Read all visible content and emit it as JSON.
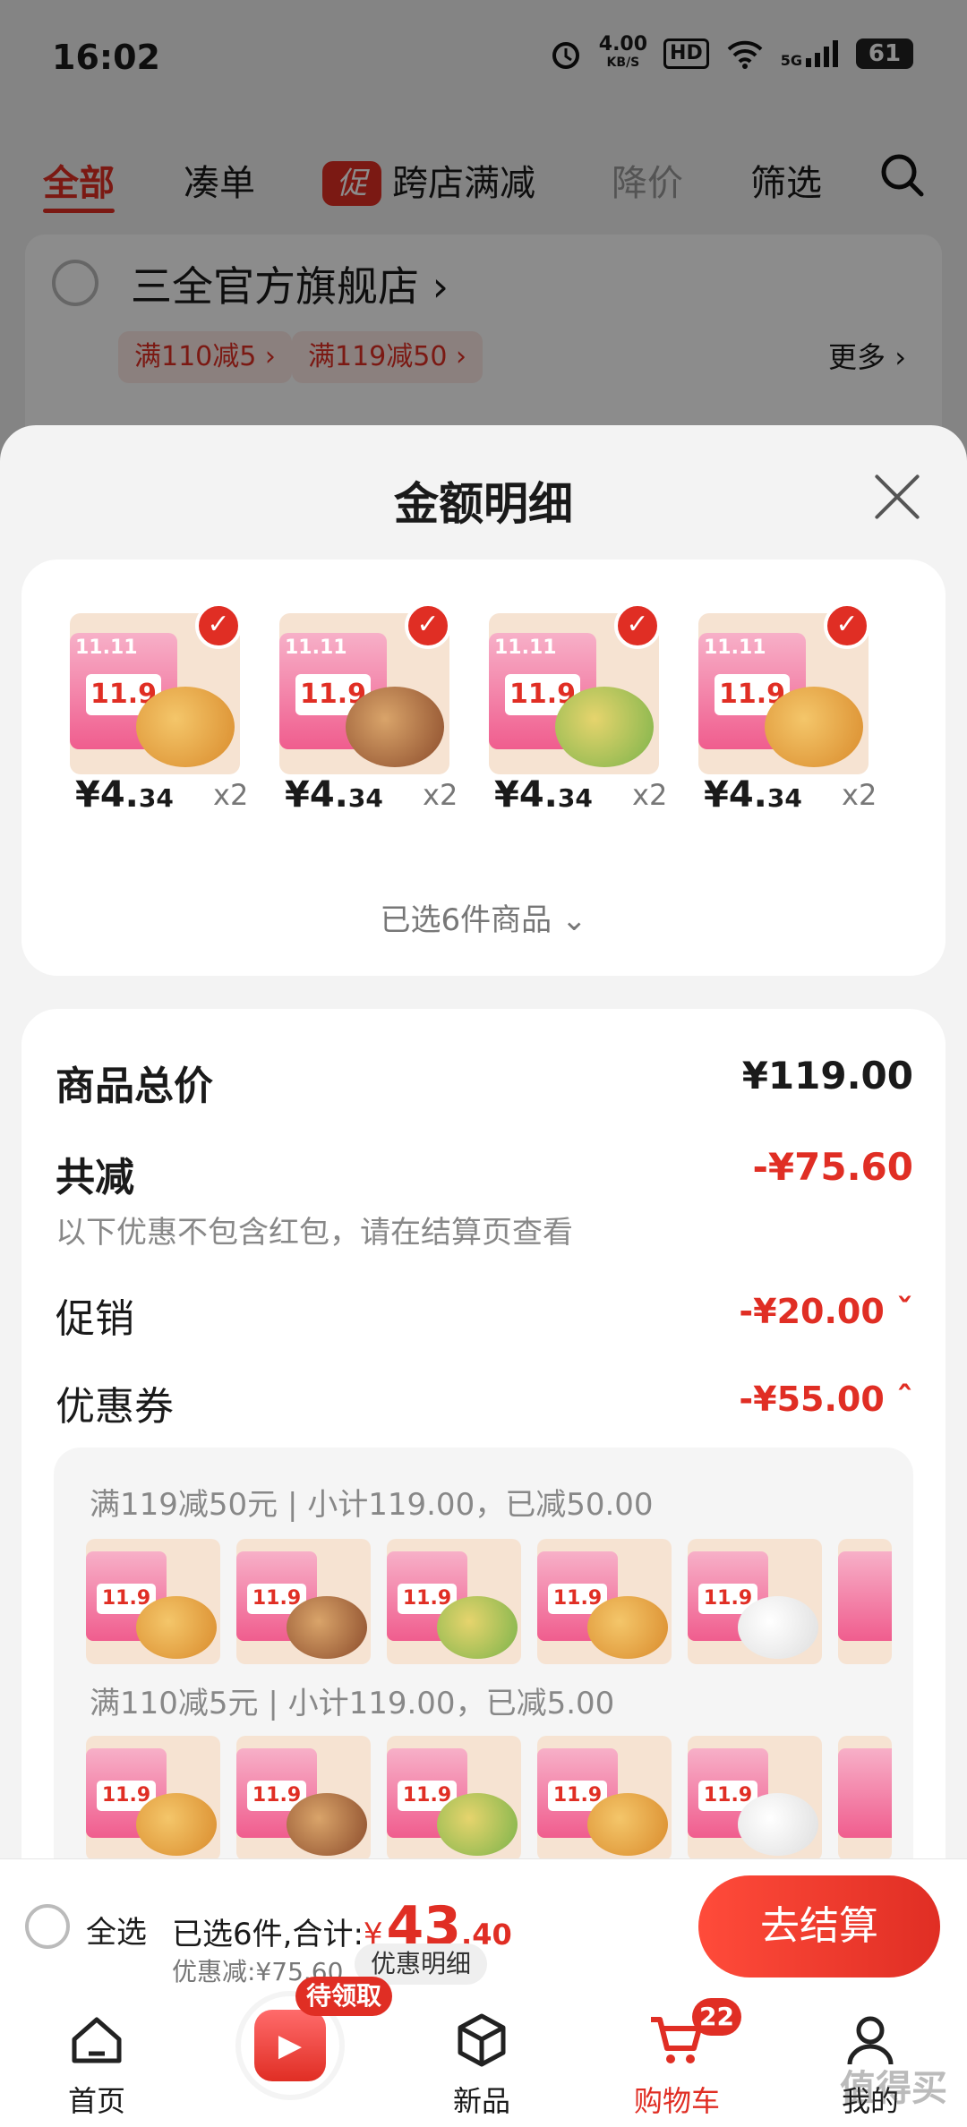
{
  "status_bar": {
    "time": "16:02",
    "speed": "4.00",
    "speed_unit": "KB/S",
    "hd": "HD",
    "network": "5G",
    "battery": "61"
  },
  "filters": {
    "all": "全部",
    "coudan": "凑单",
    "cross_icon": "促",
    "cross": "跨店满减",
    "price_drop": "降价",
    "select": "筛选"
  },
  "store": {
    "name": "三全官方旗舰店",
    "chevron": "›",
    "tags": [
      "满110减5 ›",
      "满119减50 ›"
    ],
    "more": "更多 ›"
  },
  "sheet": {
    "title": "金额明细",
    "products": [
      {
        "price_int": "¥4.",
        "price_dec": "34",
        "qty": "x2",
        "img_price": "11.9",
        "badge": "11.11"
      },
      {
        "price_int": "¥4.",
        "price_dec": "34",
        "qty": "x2",
        "img_price": "11.9",
        "badge": "11.11"
      },
      {
        "price_int": "¥4.",
        "price_dec": "34",
        "qty": "x2",
        "img_price": "11.9",
        "badge": "11.11"
      },
      {
        "price_int": "¥4.",
        "price_dec": "34",
        "qty": "x2",
        "img_price": "11.9",
        "badge": "11.11"
      }
    ],
    "selected_summary": "已选6件商品 ⌄",
    "total_label": "商品总价",
    "total_value": "¥119.00",
    "reduce_label": "共减",
    "reduce_value": "-¥75.60",
    "reduce_note": "以下优惠不包含红包，请在结算页查看",
    "promo_label": "促销",
    "promo_value": "-¥20.00 ˇ",
    "coupon_label": "优惠券",
    "coupon_value": "-¥55.00 ˆ",
    "coupon_group1": "满119减50元 | 小计119.00，已减50.00",
    "coupon_group2": "满110减5元 | 小计119.00，已减5.00",
    "mini_price": "11.9"
  },
  "checkout": {
    "select_all": "全选",
    "selected": "已选6件,合计:",
    "currency": "¥",
    "total_int": "43",
    "total_dec": ".40",
    "discount": "优惠减:¥75.60",
    "detail": "优惠明细",
    "pay": "去结算"
  },
  "tabbar": {
    "home": "首页",
    "reward_badge": "待领取",
    "new": "新品",
    "cart": "购物车",
    "cart_count": "22",
    "mine": "我的"
  },
  "watermark": "值得买"
}
